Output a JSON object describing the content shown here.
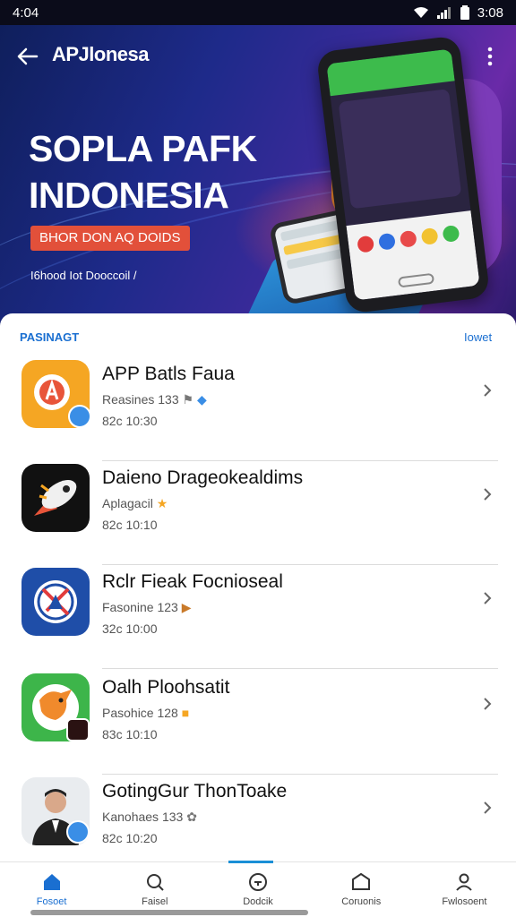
{
  "status_bar": {
    "time_left": "4:04",
    "time_right": "3:08"
  },
  "header": {
    "brand": "APJlonesa"
  },
  "hero": {
    "title_line1": "SOPLA PAFK",
    "title_line2": "INDONESIA",
    "cta": "BHOR DON AQ DOIDS",
    "subtitle": "I6hood Iot Dooccoil /"
  },
  "section": {
    "label": "PASINAGT",
    "action": "Iowet"
  },
  "apps": [
    {
      "name": "APP Batls Faua",
      "meta": "Reasines 133",
      "time": "82c 10:30",
      "icon": "app-a-icon"
    },
    {
      "name": "Daieno Dragеokealdims",
      "meta": "Aplagacil",
      "time": "82c 10:10",
      "icon": "rocket-icon"
    },
    {
      "name": "Rclr Fieak Focnioseal",
      "meta": "Fasonine 123",
      "time": "32c 10:00",
      "icon": "compass-icon"
    },
    {
      "name": "Oalh Ploohsatit",
      "meta": "Pasohice 128",
      "time": "83c 10:10",
      "icon": "fox-icon"
    },
    {
      "name": "GotingGur ThonToake",
      "meta": "Kanohaes 133",
      "time": "82c 10:20",
      "icon": "person-avatar"
    }
  ],
  "nav": [
    {
      "label": "Fosoet",
      "icon": "home-icon"
    },
    {
      "label": "Faisel",
      "icon": "search-icon"
    },
    {
      "label": "Dodcik",
      "icon": "clock-icon"
    },
    {
      "label": "Coruonis",
      "icon": "folder-icon"
    },
    {
      "label": "Fwlosoent",
      "icon": "user-icon"
    }
  ],
  "colors": {
    "accent": "#1a6fd1",
    "cta": "#e2503a",
    "hero_start": "#0f1f5c",
    "hero_end": "#6a2aa8"
  }
}
